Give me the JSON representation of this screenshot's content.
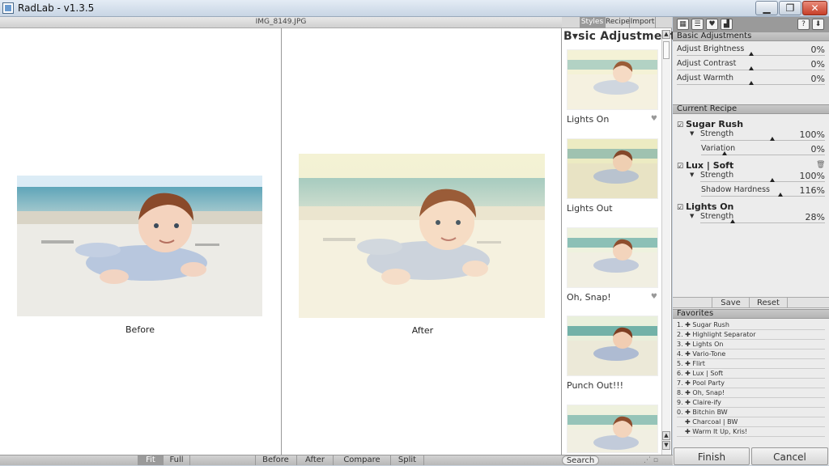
{
  "window": {
    "title": "RadLab - v1.3.5",
    "min_label": "▁",
    "max_label": "❐",
    "close_label": "✕"
  },
  "viewer": {
    "filename": "IMG_8149.JPG",
    "before_label": "Before",
    "after_label": "After"
  },
  "strip": {
    "tabs": [
      "Styles",
      "Recipe",
      "Import"
    ],
    "title": "B▾sic Adjustments",
    "thumbnails": [
      {
        "label": "Lights On",
        "favorite": true
      },
      {
        "label": "Lights Out",
        "favorite": false
      },
      {
        "label": "Oh, Snap!",
        "favorite": true
      },
      {
        "label": "Punch Out!!!",
        "favorite": false
      },
      {
        "label": "",
        "favorite": false
      }
    ]
  },
  "panel": {
    "toolbar_icons": [
      "grid-icon",
      "list-icon",
      "heart-icon",
      "chart-icon",
      "help-icon",
      "download-icon"
    ],
    "basic": {
      "header": "Basic Adjustments",
      "sliders": [
        {
          "label": "Adjust Brightness",
          "value": "0%",
          "level": 0.5
        },
        {
          "label": "Adjust Contrast",
          "value": "0%",
          "level": 0.5
        },
        {
          "label": "Adjust Warmth",
          "value": "0%",
          "level": 0.5
        }
      ]
    },
    "recipe": {
      "header": "Current Recipe",
      "styles": [
        {
          "name": "Sugar Rush",
          "sliders": [
            {
              "label": "Strength",
              "value": "100%",
              "level": 0.58
            },
            {
              "label": "Variation",
              "value": "0%",
              "level": 0.19
            }
          ]
        },
        {
          "name": "Lux | Soft",
          "sliders": [
            {
              "label": "Strength",
              "value": "100%",
              "level": 0.58
            },
            {
              "label": "Shadow Hardness",
              "value": "116%",
              "level": 0.64
            }
          ]
        },
        {
          "name": "Lights On",
          "sliders": [
            {
              "label": "Strength",
              "value": "28%",
              "level": 0.26
            }
          ]
        }
      ]
    },
    "save_label": "Save",
    "reset_label": "Reset",
    "favorites": {
      "header": "Favorites",
      "items": [
        "1. ✚ Sugar Rush",
        "2. ✚ Highlight Separator",
        "3. ✚ Lights On",
        "4. ✚ Vario-Tone",
        "5. ✚ Flirt",
        "6. ✚ Lux | Soft",
        "7. ✚ Pool Party",
        "8. ✚ Oh, Snap!",
        "9. ✚ Claire-ify",
        "0. ✚ Bitchin BW",
        "✚ Charcoal | BW",
        "✚ Warm It Up, Kris!"
      ]
    },
    "finish_label": "Finish",
    "cancel_label": "Cancel"
  },
  "bottombar": {
    "fit": "Fit",
    "full": "Full",
    "before": "Before",
    "after": "After",
    "compare": "Compare",
    "split": "Split",
    "search": "Search"
  }
}
